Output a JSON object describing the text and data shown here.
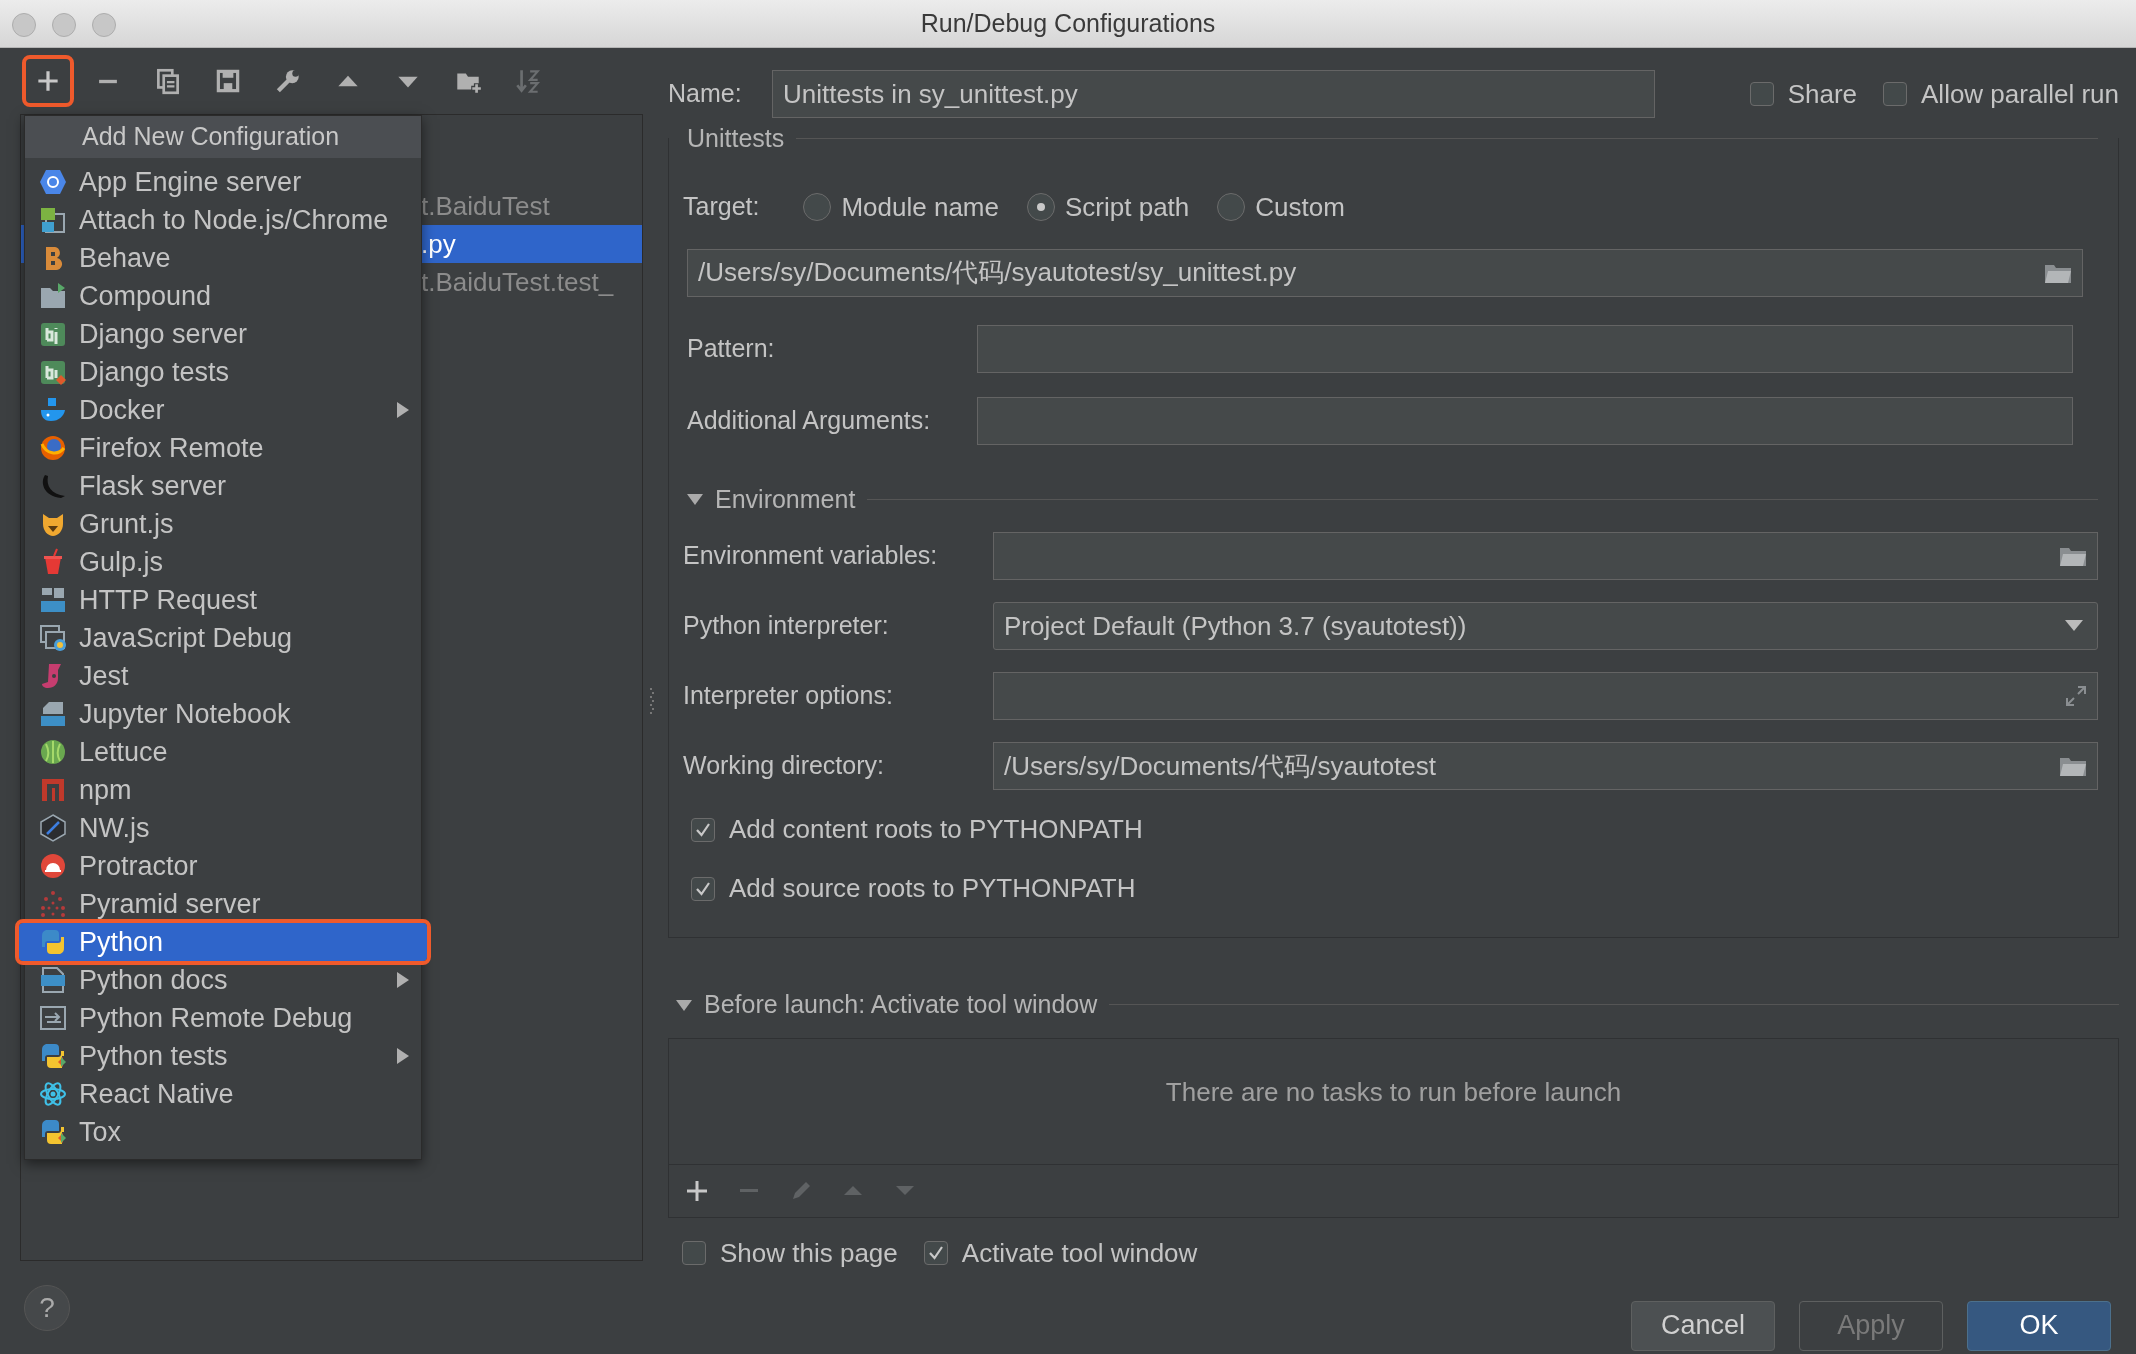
{
  "window": {
    "title": "Run/Debug Configurations"
  },
  "toolbar": {
    "add_button_outlined": true
  },
  "tree": [
    {
      "text": "t.BaiduTest",
      "selected": false
    },
    {
      "text": ".py",
      "selected": true
    },
    {
      "text": "t.BaiduTest.test_",
      "selected": false
    }
  ],
  "menu": {
    "header": "Add New Configuration",
    "items": [
      {
        "label": "App Engine server",
        "submenu": false,
        "selected": false,
        "outlined": false
      },
      {
        "label": "Attach to Node.js/Chrome",
        "submenu": false,
        "selected": false,
        "outlined": false
      },
      {
        "label": "Behave",
        "submenu": false,
        "selected": false,
        "outlined": false
      },
      {
        "label": "Compound",
        "submenu": false,
        "selected": false,
        "outlined": false
      },
      {
        "label": "Django server",
        "submenu": false,
        "selected": false,
        "outlined": false
      },
      {
        "label": "Django tests",
        "submenu": false,
        "selected": false,
        "outlined": false
      },
      {
        "label": "Docker",
        "submenu": true,
        "selected": false,
        "outlined": false
      },
      {
        "label": "Firefox Remote",
        "submenu": false,
        "selected": false,
        "outlined": false
      },
      {
        "label": "Flask server",
        "submenu": false,
        "selected": false,
        "outlined": false
      },
      {
        "label": "Grunt.js",
        "submenu": false,
        "selected": false,
        "outlined": false
      },
      {
        "label": "Gulp.js",
        "submenu": false,
        "selected": false,
        "outlined": false
      },
      {
        "label": "HTTP Request",
        "submenu": false,
        "selected": false,
        "outlined": false
      },
      {
        "label": "JavaScript Debug",
        "submenu": false,
        "selected": false,
        "outlined": false
      },
      {
        "label": "Jest",
        "submenu": false,
        "selected": false,
        "outlined": false
      },
      {
        "label": "Jupyter Notebook",
        "submenu": false,
        "selected": false,
        "outlined": false
      },
      {
        "label": "Lettuce",
        "submenu": false,
        "selected": false,
        "outlined": false
      },
      {
        "label": "npm",
        "submenu": false,
        "selected": false,
        "outlined": false
      },
      {
        "label": "NW.js",
        "submenu": false,
        "selected": false,
        "outlined": false
      },
      {
        "label": "Protractor",
        "submenu": false,
        "selected": false,
        "outlined": false
      },
      {
        "label": "Pyramid server",
        "submenu": false,
        "selected": false,
        "outlined": false
      },
      {
        "label": "Python",
        "submenu": false,
        "selected": true,
        "outlined": true
      },
      {
        "label": "Python docs",
        "submenu": true,
        "selected": false,
        "outlined": false
      },
      {
        "label": "Python Remote Debug",
        "submenu": false,
        "selected": false,
        "outlined": false
      },
      {
        "label": "Python tests",
        "submenu": true,
        "selected": false,
        "outlined": false
      },
      {
        "label": "React Native",
        "submenu": false,
        "selected": false,
        "outlined": false
      },
      {
        "label": "Tox",
        "submenu": false,
        "selected": false,
        "outlined": false
      }
    ]
  },
  "help": {
    "text": "?"
  },
  "name": {
    "label": "Name:",
    "value": "Unittests in sy_unittest.py"
  },
  "options": [
    {
      "label": "Share",
      "checked": false
    },
    {
      "label": "Allow parallel run",
      "checked": false
    }
  ],
  "unittests": {
    "title": "Unittests",
    "target_label": "Target:",
    "targets": [
      {
        "label": "Module name",
        "selected": false
      },
      {
        "label": "Script path",
        "selected": true
      },
      {
        "label": "Custom",
        "selected": false
      }
    ],
    "script_path": "/Users/sy/Documents/代码/syautotest/sy_unittest.py",
    "pattern_label": "Pattern:",
    "arguments_label": "Additional Arguments:"
  },
  "environment": {
    "title": "Environment",
    "expanded": true,
    "env_label": "Environment variables:",
    "interpreter_label": "Python interpreter:",
    "interpreter": "Project Default (Python 3.7 (syautotest))",
    "options_label": "Interpreter options:",
    "workdir_label": "Working directory:",
    "workdir": "/Users/sy/Documents/代码/syautotest",
    "checks": [
      {
        "label": "Add content roots to PYTHONPATH",
        "checked": true
      },
      {
        "label": "Add source roots to PYTHONPATH",
        "checked": true
      }
    ]
  },
  "before_launch": {
    "title": "Before launch: Activate tool window",
    "expanded": true,
    "empty_text": "There are no tasks to run before launch",
    "checks": [
      {
        "label": "Show this page",
        "checked": false
      },
      {
        "label": "Activate tool window",
        "checked": true
      }
    ]
  },
  "buttons": [
    {
      "label": "Cancel",
      "kind": "normal"
    },
    {
      "label": "Apply",
      "kind": "disabled"
    },
    {
      "label": "OK",
      "kind": "default"
    }
  ]
}
